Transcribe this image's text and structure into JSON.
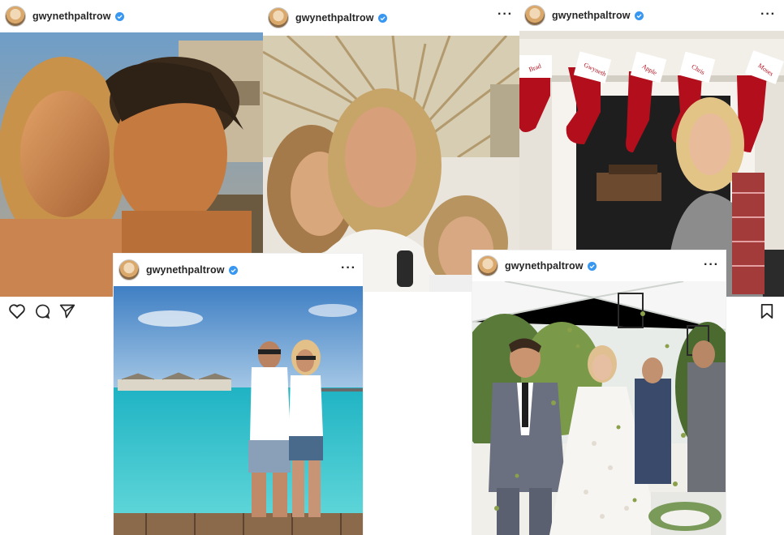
{
  "posts": [
    {
      "username": "gwynethpaltrow",
      "more": "···",
      "photo_desc": "selfie-couple-sunset"
    },
    {
      "username": "gwynethpaltrow",
      "more": "···",
      "photo_desc": "selfie-family-palm"
    },
    {
      "username": "gwynethpaltrow",
      "more": "···",
      "photo_desc": "christmas-stockings-fireplace"
    },
    {
      "username": "gwynethpaltrow",
      "more": "···",
      "photo_desc": "couple-maldives-pier"
    },
    {
      "username": "gwynethpaltrow",
      "more": "···",
      "photo_desc": "wedding-recessional"
    }
  ],
  "stockings": [
    "Brad",
    "Gwyneth",
    "Apple",
    "Chris",
    "Moses"
  ],
  "actions": {
    "like": "heart-icon",
    "comment": "comment-icon",
    "share": "share-icon",
    "save": "bookmark-icon"
  },
  "colors": {
    "verified": "#3897f0",
    "text": "#262626"
  }
}
